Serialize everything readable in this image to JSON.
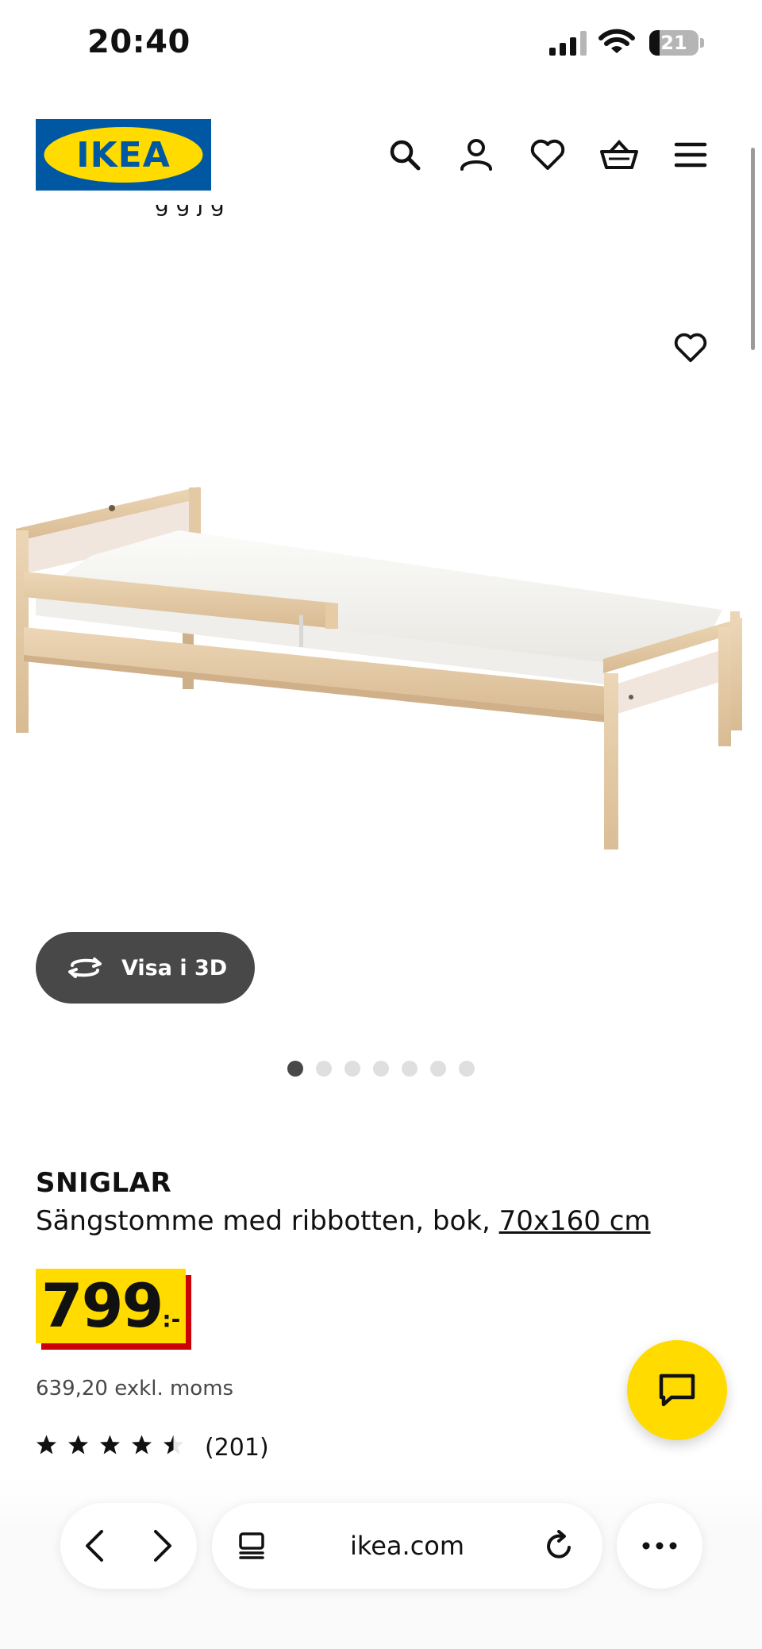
{
  "status_bar": {
    "time": "20:40",
    "battery_level": "21",
    "icons": [
      "signal-icon",
      "wifi-icon",
      "battery-icon"
    ]
  },
  "header": {
    "logo_text": "IKEA",
    "icons": [
      "search-icon",
      "account-icon",
      "favorites-icon",
      "cart-icon",
      "menu-icon"
    ]
  },
  "gallery": {
    "view_3d_label": "Visa i 3D",
    "image_count": 7,
    "active_index": 0
  },
  "product": {
    "name": "SNIGLAR",
    "description": "Sängstomme med ribbotten, bok, ",
    "size": "70x160 cm",
    "price_integer": "799",
    "price_suffix": ":-",
    "price_excl_vat": "639,20 exkl. moms",
    "rating": 4.5,
    "rating_max": 5,
    "review_count": "(201)"
  },
  "browser": {
    "url": "ikea.com"
  },
  "colors": {
    "ikea_blue": "#0058a3",
    "ikea_yellow": "#ffdb00",
    "price_red": "#cc0008",
    "button_dark": "#484848"
  }
}
